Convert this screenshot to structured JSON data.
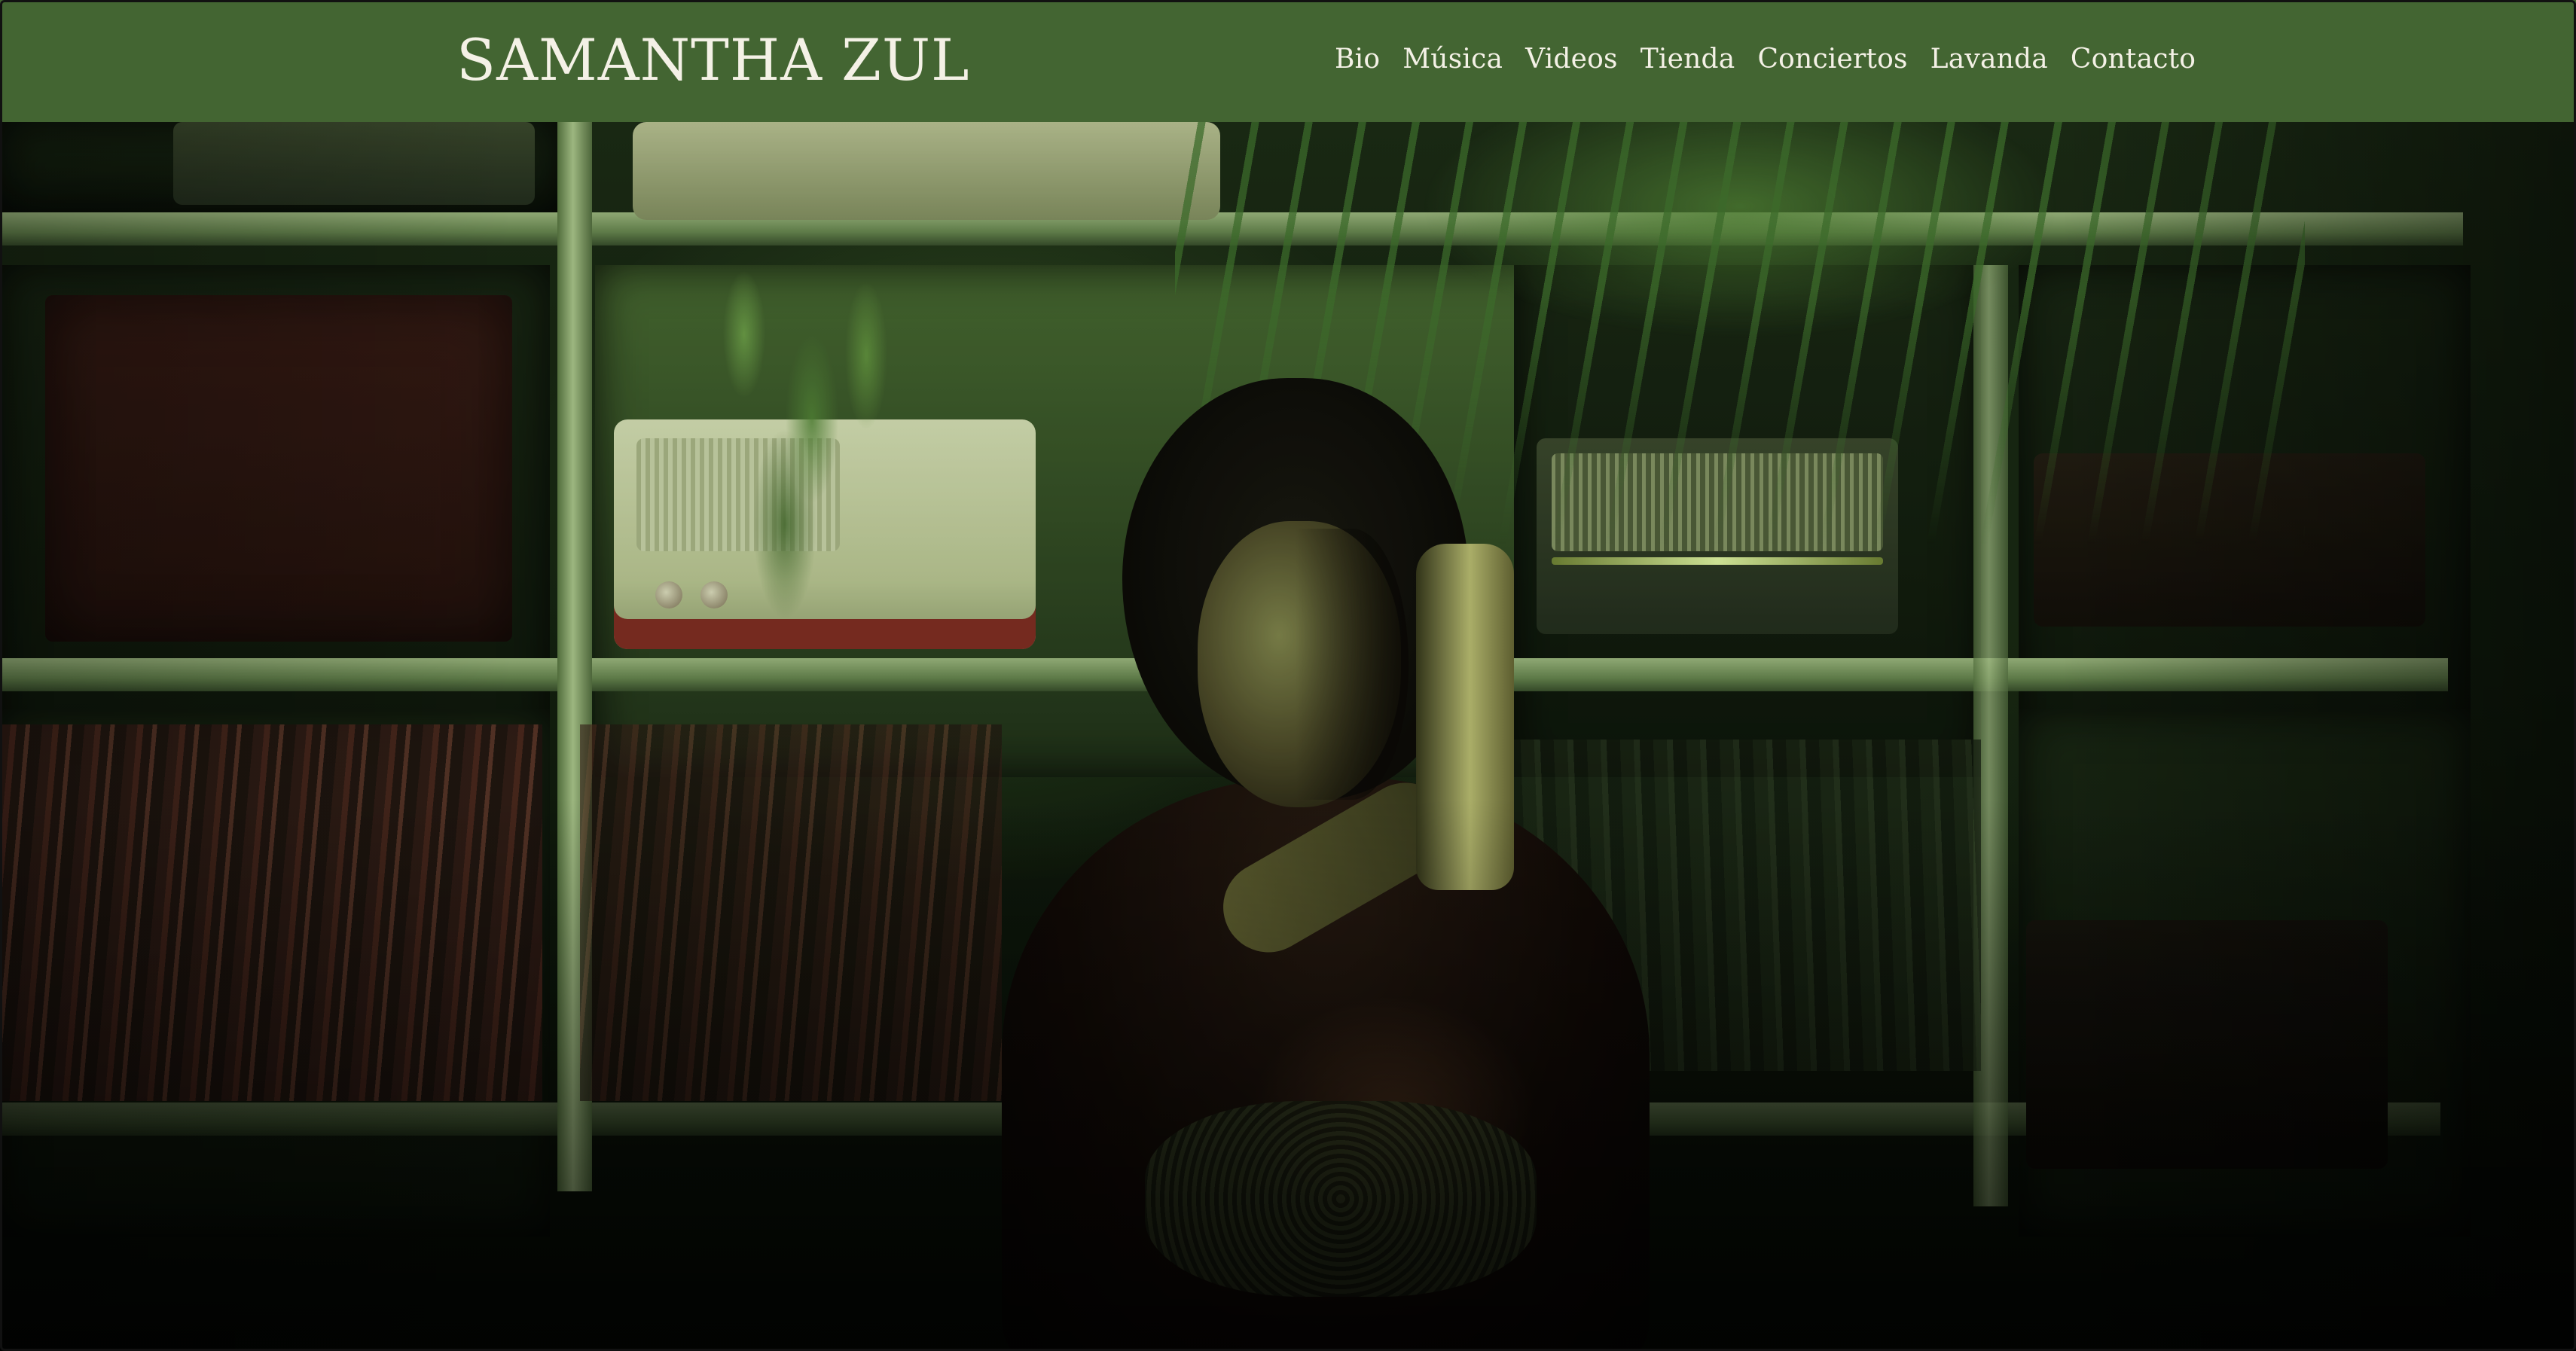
{
  "header": {
    "logo_text": "SAMANTHA ZUL",
    "background_color": "#436532",
    "text_color": "#f4f1e6"
  },
  "nav": {
    "items": [
      {
        "label": "Bio"
      },
      {
        "label": "Música"
      },
      {
        "label": "Videos"
      },
      {
        "label": "Tienda"
      },
      {
        "label": "Conciertos"
      },
      {
        "label": "Lavanda"
      },
      {
        "label": "Contacto"
      }
    ]
  },
  "hero": {
    "image_alt": ""
  }
}
